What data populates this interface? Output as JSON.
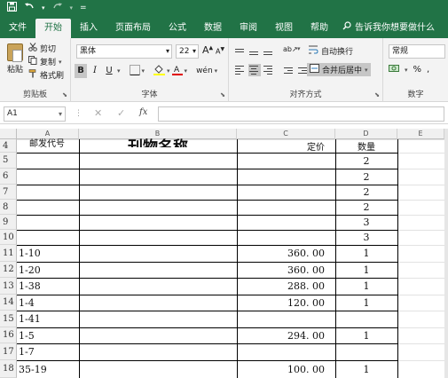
{
  "quick_access": {
    "save_icon": "save-icon",
    "undo_icon": "undo-icon",
    "redo_icon": "redo-icon",
    "customize": "="
  },
  "tabs": [
    "文件",
    "开始",
    "插入",
    "页面布局",
    "公式",
    "数据",
    "审阅",
    "视图",
    "帮助"
  ],
  "active_tab": "开始",
  "tell_me": "告诉我你想要做什么",
  "ribbon": {
    "clipboard": {
      "paste": "粘贴",
      "cut": "剪切",
      "copy": "复制",
      "format_painter": "格式刷",
      "label": "剪贴板"
    },
    "font": {
      "name": "黑体",
      "size": "22",
      "bold": "B",
      "italic": "I",
      "underline": "U",
      "grow": "A",
      "shrink": "A",
      "label": "字体"
    },
    "alignment": {
      "wrap": "自动换行",
      "merge": "合并后居中",
      "label": "对齐方式"
    },
    "number": {
      "format": "常规",
      "percent": "%",
      "comma": ",",
      "label": "数字"
    }
  },
  "formula_bar": {
    "name_box": "A1",
    "sep": "⋮",
    "cancel": "✕",
    "enter": "✓",
    "fx": "fx",
    "value": ""
  },
  "columns": [
    "A",
    "B",
    "C",
    "D",
    "E"
  ],
  "rows": [
    {
      "num": "4",
      "a": "邮发代号",
      "b": "刊物名称",
      "c": "定价",
      "d": "数量"
    },
    {
      "num": "5",
      "a": "",
      "b": "",
      "c": "",
      "d": "2"
    },
    {
      "num": "6",
      "a": "",
      "b": "",
      "c": "",
      "d": "2"
    },
    {
      "num": "7",
      "a": "",
      "b": "",
      "c": "",
      "d": "2"
    },
    {
      "num": "8",
      "a": "",
      "b": "",
      "c": "",
      "d": "2"
    },
    {
      "num": "9",
      "a": "",
      "b": "",
      "c": "",
      "d": "3"
    },
    {
      "num": "10",
      "a": "",
      "b": "",
      "c": "",
      "d": "3"
    },
    {
      "num": "11",
      "a": "1-10",
      "b": "",
      "c": "360. 00",
      "d": "1"
    },
    {
      "num": "12",
      "a": "1-20",
      "b": "",
      "c": "360. 00",
      "d": "1"
    },
    {
      "num": "13",
      "a": "1-38",
      "b": "",
      "c": "288. 00",
      "d": "1"
    },
    {
      "num": "14",
      "a": "1-4",
      "b": "",
      "c": "120. 00",
      "d": "1"
    },
    {
      "num": "15",
      "a": "1-41",
      "b": "",
      "c": "",
      "d": ""
    },
    {
      "num": "16",
      "a": "1-5",
      "b": "",
      "c": "294. 00",
      "d": "1"
    },
    {
      "num": "17",
      "a": "1-7",
      "b": "",
      "c": "",
      "d": ""
    },
    {
      "num": "18",
      "a": "35-19",
      "b": "",
      "c": "100. 00",
      "d": "1"
    }
  ]
}
